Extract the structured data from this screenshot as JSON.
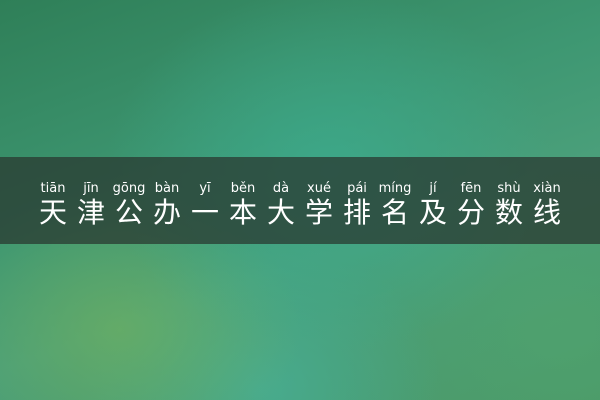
{
  "title": {
    "characters": [
      {
        "hanzi": "天",
        "pinyin": "tiān"
      },
      {
        "hanzi": "津",
        "pinyin": "jīn"
      },
      {
        "hanzi": "公",
        "pinyin": "gōng"
      },
      {
        "hanzi": "办",
        "pinyin": "bàn"
      },
      {
        "hanzi": "一",
        "pinyin": "yī"
      },
      {
        "hanzi": "本",
        "pinyin": "běn"
      },
      {
        "hanzi": "大",
        "pinyin": "dà"
      },
      {
        "hanzi": "学",
        "pinyin": "xué"
      },
      {
        "hanzi": "排",
        "pinyin": "pái"
      },
      {
        "hanzi": "名",
        "pinyin": "míng"
      },
      {
        "hanzi": "及",
        "pinyin": "jí"
      },
      {
        "hanzi": "分",
        "pinyin": "fēn"
      },
      {
        "hanzi": "数",
        "pinyin": "shù"
      },
      {
        "hanzi": "线",
        "pinyin": "xiàn"
      }
    ]
  },
  "colors": {
    "band": "#28342e",
    "text": "#ffffff",
    "background_primary": "#3e9772"
  }
}
